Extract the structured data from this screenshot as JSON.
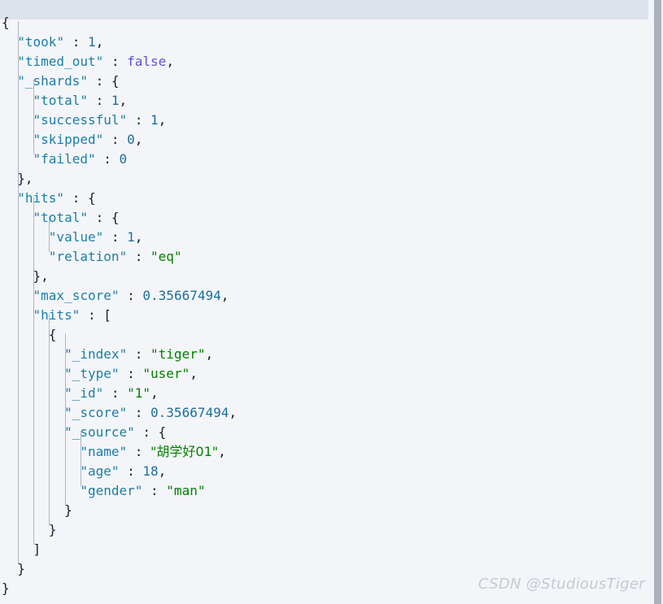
{
  "editor": {
    "background_color": "#f4f5f9",
    "active_line_color": "#dce3ec",
    "indent_guide_color": "#a9b7c6",
    "font_size_px": 16,
    "line_height_px": 24,
    "total_lines": 29
  },
  "colors": {
    "key": "#1a7ea8",
    "string": "#008000",
    "number": "#1a6e9e",
    "boolean": "#5b52d6",
    "punctuation": "#1a1a2e",
    "scrollbar": "#aab2c0",
    "watermark": "#c5c9d2"
  },
  "scrollbar": {
    "orientation": "vertical",
    "thumb_color": "#aab2c0"
  },
  "watermark": {
    "text": "CSDN @StudiousTiger"
  },
  "document": {
    "language": "json",
    "lines": [
      {
        "indent": 0,
        "tokens": [
          {
            "t": "p",
            "v": "{"
          }
        ]
      },
      {
        "indent": 1,
        "tokens": [
          {
            "t": "k",
            "v": "\"took\""
          },
          {
            "t": "p",
            "v": " : "
          },
          {
            "t": "n",
            "v": "1"
          },
          {
            "t": "p",
            "v": ","
          }
        ]
      },
      {
        "indent": 1,
        "tokens": [
          {
            "t": "k",
            "v": "\"timed_out\""
          },
          {
            "t": "p",
            "v": " : "
          },
          {
            "t": "b",
            "v": "false"
          },
          {
            "t": "p",
            "v": ","
          }
        ]
      },
      {
        "indent": 1,
        "tokens": [
          {
            "t": "k",
            "v": "\"_shards\""
          },
          {
            "t": "p",
            "v": " : {"
          }
        ]
      },
      {
        "indent": 2,
        "tokens": [
          {
            "t": "k",
            "v": "\"total\""
          },
          {
            "t": "p",
            "v": " : "
          },
          {
            "t": "n",
            "v": "1"
          },
          {
            "t": "p",
            "v": ","
          }
        ]
      },
      {
        "indent": 2,
        "tokens": [
          {
            "t": "k",
            "v": "\"successful\""
          },
          {
            "t": "p",
            "v": " : "
          },
          {
            "t": "n",
            "v": "1"
          },
          {
            "t": "p",
            "v": ","
          }
        ]
      },
      {
        "indent": 2,
        "tokens": [
          {
            "t": "k",
            "v": "\"skipped\""
          },
          {
            "t": "p",
            "v": " : "
          },
          {
            "t": "n",
            "v": "0"
          },
          {
            "t": "p",
            "v": ","
          }
        ]
      },
      {
        "indent": 2,
        "tokens": [
          {
            "t": "k",
            "v": "\"failed\""
          },
          {
            "t": "p",
            "v": " : "
          },
          {
            "t": "n",
            "v": "0"
          }
        ]
      },
      {
        "indent": 1,
        "tokens": [
          {
            "t": "p",
            "v": "},"
          }
        ]
      },
      {
        "indent": 1,
        "tokens": [
          {
            "t": "k",
            "v": "\"hits\""
          },
          {
            "t": "p",
            "v": " : {"
          }
        ]
      },
      {
        "indent": 2,
        "tokens": [
          {
            "t": "k",
            "v": "\"total\""
          },
          {
            "t": "p",
            "v": " : {"
          }
        ]
      },
      {
        "indent": 3,
        "tokens": [
          {
            "t": "k",
            "v": "\"value\""
          },
          {
            "t": "p",
            "v": " : "
          },
          {
            "t": "n",
            "v": "1"
          },
          {
            "t": "p",
            "v": ","
          }
        ]
      },
      {
        "indent": 3,
        "tokens": [
          {
            "t": "k",
            "v": "\"relation\""
          },
          {
            "t": "p",
            "v": " : "
          },
          {
            "t": "s",
            "v": "\"eq\""
          }
        ]
      },
      {
        "indent": 2,
        "tokens": [
          {
            "t": "p",
            "v": "},"
          }
        ]
      },
      {
        "indent": 2,
        "tokens": [
          {
            "t": "k",
            "v": "\"max_score\""
          },
          {
            "t": "p",
            "v": " : "
          },
          {
            "t": "n",
            "v": "0.35667494"
          },
          {
            "t": "p",
            "v": ","
          }
        ]
      },
      {
        "indent": 2,
        "tokens": [
          {
            "t": "k",
            "v": "\"hits\""
          },
          {
            "t": "p",
            "v": " : ["
          }
        ]
      },
      {
        "indent": 3,
        "tokens": [
          {
            "t": "p",
            "v": "{"
          }
        ]
      },
      {
        "indent": 4,
        "tokens": [
          {
            "t": "k",
            "v": "\"_index\""
          },
          {
            "t": "p",
            "v": " : "
          },
          {
            "t": "s",
            "v": "\"tiger\""
          },
          {
            "t": "p",
            "v": ","
          }
        ]
      },
      {
        "indent": 4,
        "tokens": [
          {
            "t": "k",
            "v": "\"_type\""
          },
          {
            "t": "p",
            "v": " : "
          },
          {
            "t": "s",
            "v": "\"user\""
          },
          {
            "t": "p",
            "v": ","
          }
        ]
      },
      {
        "indent": 4,
        "tokens": [
          {
            "t": "k",
            "v": "\"_id\""
          },
          {
            "t": "p",
            "v": " : "
          },
          {
            "t": "s",
            "v": "\"1\""
          },
          {
            "t": "p",
            "v": ","
          }
        ]
      },
      {
        "indent": 4,
        "tokens": [
          {
            "t": "k",
            "v": "\"_score\""
          },
          {
            "t": "p",
            "v": " : "
          },
          {
            "t": "n",
            "v": "0.35667494"
          },
          {
            "t": "p",
            "v": ","
          }
        ]
      },
      {
        "indent": 4,
        "tokens": [
          {
            "t": "k",
            "v": "\"_source\""
          },
          {
            "t": "p",
            "v": " : {"
          }
        ]
      },
      {
        "indent": 5,
        "tokens": [
          {
            "t": "k",
            "v": "\"name\""
          },
          {
            "t": "p",
            "v": " : "
          },
          {
            "t": "s",
            "v": "\"胡学好01\"",
            "cjk": true
          },
          {
            "t": "p",
            "v": ","
          }
        ]
      },
      {
        "indent": 5,
        "tokens": [
          {
            "t": "k",
            "v": "\"age\""
          },
          {
            "t": "p",
            "v": " : "
          },
          {
            "t": "n",
            "v": "18"
          },
          {
            "t": "p",
            "v": ","
          }
        ]
      },
      {
        "indent": 5,
        "tokens": [
          {
            "t": "k",
            "v": "\"gender\""
          },
          {
            "t": "p",
            "v": " : "
          },
          {
            "t": "s",
            "v": "\"man\""
          }
        ]
      },
      {
        "indent": 4,
        "tokens": [
          {
            "t": "p",
            "v": "}"
          }
        ]
      },
      {
        "indent": 3,
        "tokens": [
          {
            "t": "p",
            "v": "}"
          }
        ]
      },
      {
        "indent": 2,
        "tokens": [
          {
            "t": "p",
            "v": "]"
          }
        ]
      },
      {
        "indent": 1,
        "tokens": [
          {
            "t": "p",
            "v": "}"
          }
        ]
      },
      {
        "indent": 0,
        "tokens": [
          {
            "t": "p",
            "v": "}"
          }
        ]
      }
    ]
  }
}
